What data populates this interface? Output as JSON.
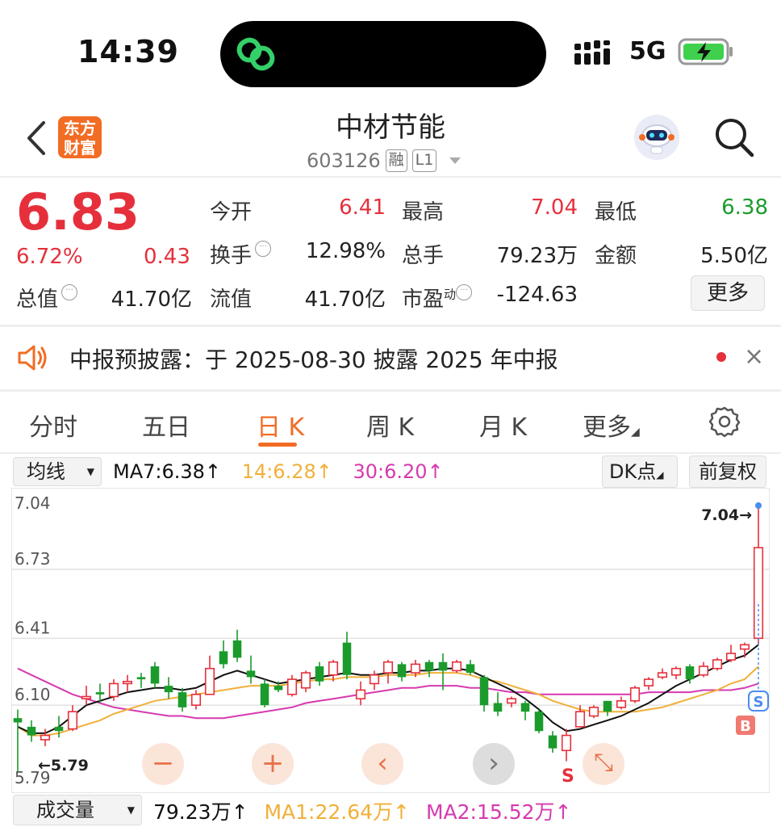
{
  "status_bar": {
    "time": "14:39",
    "network": "5G"
  },
  "header": {
    "title": "中材节能",
    "code": "603126",
    "tag_margin": "融",
    "tag_level": "L1",
    "logo_line1": "东方",
    "logo_line2": "财富"
  },
  "quote": {
    "price": "6.83",
    "change_pct": "6.72%",
    "change_amt": "0.43",
    "fields": {
      "open_label": "今开",
      "open": "6.41",
      "high_label": "最高",
      "high": "7.04",
      "low_label": "最低",
      "low": "6.38",
      "turnover_label": "换手",
      "turnover": "12.98%",
      "volume_label": "总手",
      "volume": "79.23万",
      "amount_label": "金额",
      "amount": "5.50亿",
      "total_mv_label": "总值",
      "total_mv": "41.70亿",
      "float_mv_label": "流值",
      "float_mv": "41.70亿",
      "pe_label": "市盈",
      "pe_sup": "动",
      "pe": "-124.63"
    },
    "more_label": "更多"
  },
  "notice": {
    "text": "中报预披露：于 2025-08-30 披露 2025 年中报",
    "close": "×"
  },
  "tabs": [
    {
      "label": "分时"
    },
    {
      "label": "五日"
    },
    {
      "label": "日 K"
    },
    {
      "label": "周 K"
    },
    {
      "label": "月 K"
    },
    {
      "label": "更多"
    }
  ],
  "chart_header": {
    "indicator_select": "均线",
    "ma7": "MA7:6.38",
    "ma14": "14:6.28",
    "ma30": "30:6.20",
    "dk_label": "DK点",
    "adjust_label": "前复权",
    "arrow": "↑"
  },
  "chart_data": {
    "type": "candlestick",
    "ylim": [
      5.79,
      7.04
    ],
    "y_ticks": [
      "7.04",
      "6.73",
      "6.41",
      "6.10",
      "5.79"
    ],
    "max_label": "7.04→",
    "min_label": "5.79",
    "signals": {
      "sell": "S",
      "buy": "B",
      "sell_box": "S"
    },
    "candles": [
      [
        6.04,
        6.02,
        6.08,
        5.79
      ],
      [
        6.0,
        5.96,
        6.03,
        5.93
      ],
      [
        5.94,
        5.96,
        5.99,
        5.91
      ],
      [
        6.0,
        5.98,
        6.05,
        5.95
      ],
      [
        5.99,
        6.07,
        6.1,
        5.98
      ],
      [
        6.13,
        6.14,
        6.19,
        6.1
      ],
      [
        6.16,
        6.15,
        6.2,
        6.11
      ],
      [
        6.14,
        6.2,
        6.22,
        6.12
      ],
      [
        6.2,
        6.21,
        6.24,
        6.16
      ],
      [
        6.23,
        6.22,
        6.25,
        6.18
      ],
      [
        6.28,
        6.2,
        6.3,
        6.18
      ],
      [
        6.19,
        6.16,
        6.23,
        6.13
      ],
      [
        6.16,
        6.09,
        6.18,
        6.07
      ],
      [
        6.1,
        6.15,
        6.17,
        6.08
      ],
      [
        6.15,
        6.27,
        6.33,
        6.15
      ],
      [
        6.35,
        6.29,
        6.4,
        6.27
      ],
      [
        6.4,
        6.32,
        6.45,
        6.3
      ],
      [
        6.26,
        6.23,
        6.33,
        6.2
      ],
      [
        6.2,
        6.1,
        6.22,
        6.09
      ],
      [
        6.19,
        6.17,
        6.21,
        6.16
      ],
      [
        6.15,
        6.22,
        6.24,
        6.14
      ],
      [
        6.18,
        6.25,
        6.26,
        6.16
      ],
      [
        6.28,
        6.21,
        6.3,
        6.19
      ],
      [
        6.24,
        6.3,
        6.31,
        6.21
      ],
      [
        6.39,
        6.24,
        6.44,
        6.22
      ],
      [
        6.13,
        6.17,
        6.21,
        6.1
      ],
      [
        6.2,
        6.24,
        6.26,
        6.17
      ],
      [
        6.25,
        6.3,
        6.31,
        6.2
      ],
      [
        6.29,
        6.23,
        6.3,
        6.21
      ],
      [
        6.25,
        6.29,
        6.31,
        6.23
      ],
      [
        6.3,
        6.26,
        6.31,
        6.23
      ],
      [
        6.3,
        6.26,
        6.34,
        6.17
      ],
      [
        6.26,
        6.3,
        6.31,
        6.25
      ],
      [
        6.29,
        6.25,
        6.31,
        6.24
      ],
      [
        6.23,
        6.1,
        6.24,
        6.07
      ],
      [
        6.11,
        6.07,
        6.16,
        6.05
      ],
      [
        6.11,
        6.13,
        6.14,
        6.09
      ],
      [
        6.11,
        6.07,
        6.12,
        6.03
      ],
      [
        6.07,
        5.98,
        6.08,
        5.97
      ],
      [
        5.96,
        5.9,
        5.98,
        5.88
      ],
      [
        5.89,
        5.96,
        5.99,
        5.84
      ],
      [
        6.0,
        6.07,
        6.1,
        6.0
      ],
      [
        6.05,
        6.09,
        6.1,
        6.04
      ],
      [
        6.12,
        6.07,
        6.12,
        6.05
      ],
      [
        6.09,
        6.12,
        6.14,
        6.08
      ],
      [
        6.12,
        6.18,
        6.19,
        6.11
      ],
      [
        6.19,
        6.22,
        6.23,
        6.17
      ],
      [
        6.23,
        6.25,
        6.27,
        6.22
      ],
      [
        6.24,
        6.27,
        6.28,
        6.22
      ],
      [
        6.28,
        6.22,
        6.29,
        6.2
      ],
      [
        6.24,
        6.28,
        6.3,
        6.23
      ],
      [
        6.27,
        6.31,
        6.32,
        6.26
      ],
      [
        6.31,
        6.34,
        6.38,
        6.3
      ],
      [
        6.36,
        6.38,
        6.39,
        6.32
      ],
      [
        6.41,
        6.83,
        7.04,
        6.38
      ]
    ],
    "ma7": [
      6.0,
      5.97,
      5.97,
      6.0,
      6.05,
      6.1,
      6.12,
      6.14,
      6.16,
      6.17,
      6.18,
      6.18,
      6.17,
      6.18,
      6.21,
      6.24,
      6.26,
      6.24,
      6.22,
      6.2,
      6.21,
      6.22,
      6.23,
      6.24,
      6.25,
      6.24,
      6.24,
      6.25,
      6.25,
      6.26,
      6.26,
      6.27,
      6.27,
      6.26,
      6.23,
      6.2,
      6.17,
      6.13,
      6.08,
      6.02,
      5.98,
      5.99,
      6.01,
      6.03,
      6.05,
      6.08,
      6.11,
      6.15,
      6.19,
      6.22,
      6.25,
      6.28,
      6.31,
      6.33,
      6.38
    ],
    "ma14": [
      6.0,
      5.96,
      5.96,
      5.97,
      5.99,
      6.01,
      6.03,
      6.06,
      6.08,
      6.1,
      6.12,
      6.13,
      6.14,
      6.15,
      6.16,
      6.17,
      6.18,
      6.19,
      6.19,
      6.19,
      6.2,
      6.21,
      6.22,
      6.22,
      6.23,
      6.23,
      6.23,
      6.24,
      6.24,
      6.24,
      6.25,
      6.25,
      6.25,
      6.24,
      6.22,
      6.21,
      6.19,
      6.17,
      6.15,
      6.12,
      6.1,
      6.08,
      6.07,
      6.07,
      6.07,
      6.07,
      6.08,
      6.09,
      6.11,
      6.13,
      6.15,
      6.17,
      6.2,
      6.22,
      6.28
    ],
    "ma30": [
      6.27,
      6.24,
      6.21,
      6.18,
      6.15,
      6.13,
      6.11,
      6.09,
      6.08,
      6.07,
      6.06,
      6.05,
      6.05,
      6.04,
      6.04,
      6.04,
      6.05,
      6.06,
      6.07,
      6.08,
      6.09,
      6.11,
      6.12,
      6.13,
      6.14,
      6.15,
      6.16,
      6.17,
      6.18,
      6.18,
      6.19,
      6.19,
      6.19,
      6.18,
      6.18,
      6.17,
      6.16,
      6.16,
      6.15,
      6.15,
      6.15,
      6.15,
      6.15,
      6.15,
      6.15,
      6.15,
      6.16,
      6.16,
      6.16,
      6.16,
      6.17,
      6.17,
      6.17,
      6.18,
      6.2
    ]
  },
  "controls": {
    "zoom_out": "−",
    "zoom_in": "+",
    "prev": "‹",
    "next": "›",
    "fullscreen": "⤡"
  },
  "volume_row": {
    "select": "成交量",
    "vol": "79.23万↑",
    "ma1": "MA1:22.64万↑",
    "ma2": "MA2:15.52万↑"
  },
  "colors": {
    "up": "#e5303c",
    "down": "#1a9b2c",
    "accent": "#f26c24",
    "ma7": "#111111",
    "ma14": "#f0b03a",
    "ma30": "#d63ab0"
  }
}
